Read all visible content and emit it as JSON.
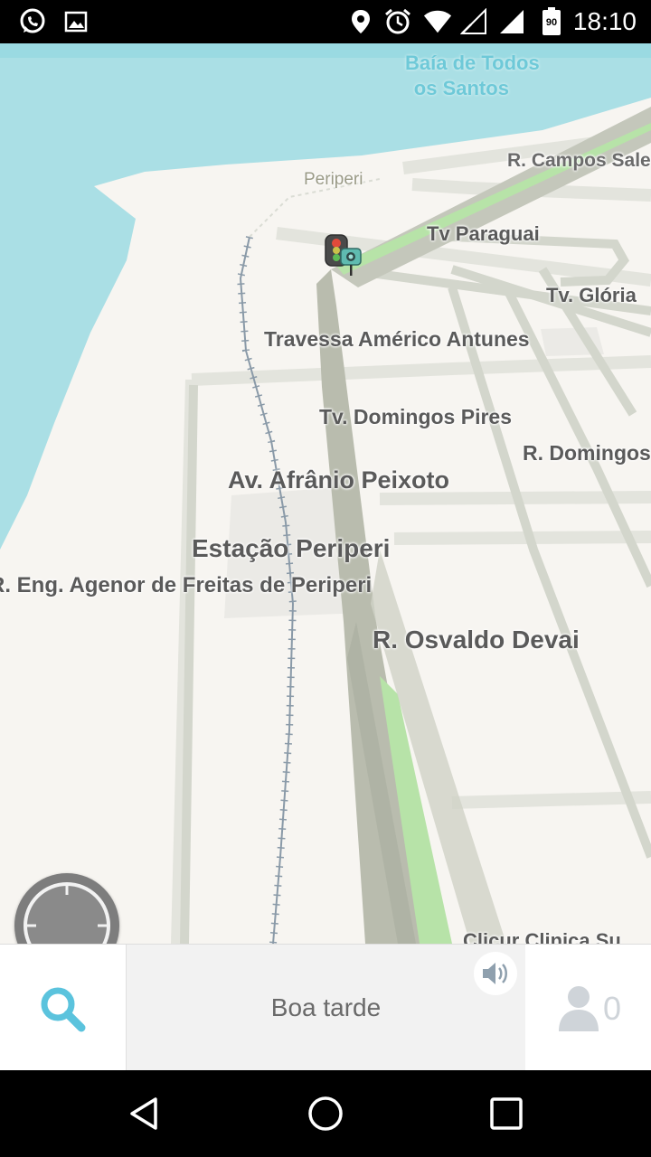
{
  "status_bar": {
    "icons": [
      "whatsapp-icon",
      "gallery-icon",
      "location-icon",
      "alarm-icon",
      "wifi-icon",
      "signal-empty-icon",
      "signal-full-icon",
      "battery-icon"
    ],
    "battery_level": "90",
    "time": "18:10"
  },
  "map": {
    "water_label_line1": "Baía de Todos",
    "water_label_line2": "os Santos",
    "labels": {
      "campos_sales": "R. Campos Sales",
      "periperi": "Periperi",
      "paraguai": "Tv Paraguai",
      "gloria": "Tv. Glória",
      "americo": "Travessa Américo Antunes",
      "domingos_pires": "Tv. Domingos Pires",
      "domingos": "R. Domingos",
      "afranio": "Av. Afrânio Peixoto",
      "estacao": "Estação Periperi",
      "agenor": "R. Eng. Agenor de Freitas de Periperi",
      "osvaldo": "R. Osvaldo Devai",
      "clinics": "Clicur   Clinica Su"
    },
    "colors": {
      "water": "#aadfe5",
      "land": "#f7f5f1",
      "road": "#d3d6cc",
      "highway": "#b9bcae",
      "green_strip": "#b7e3a8"
    }
  },
  "bottom_bar": {
    "greeting": "Boa tarde",
    "users_count": "0",
    "accent": "#5bc3dd"
  },
  "nav_bar": {
    "buttons": [
      "back-icon",
      "home-icon",
      "recents-icon"
    ]
  }
}
